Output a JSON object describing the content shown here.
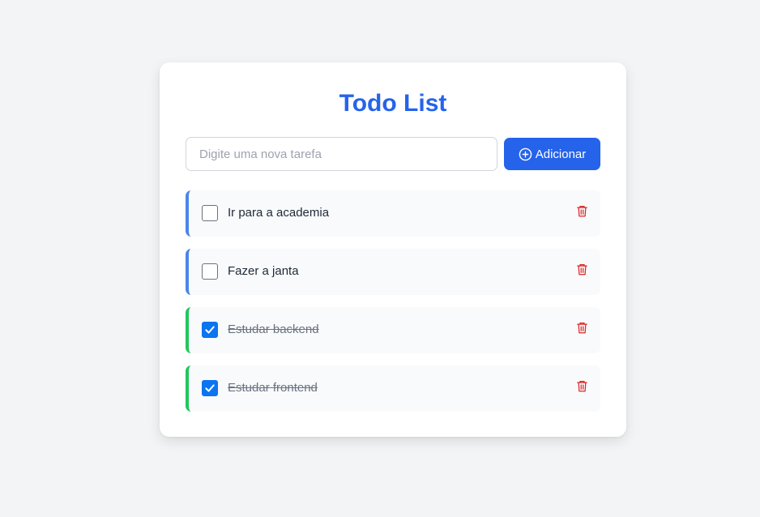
{
  "app": {
    "title": "Todo List"
  },
  "input": {
    "value": "",
    "placeholder": "Digite uma nova tarefa"
  },
  "add_button": {
    "label": "Adicionar",
    "icon": "plus-circle-icon"
  },
  "todos": [
    {
      "text": "Ir para a academia",
      "completed": false,
      "delete_icon": "trash-icon"
    },
    {
      "text": "Fazer a janta",
      "completed": false,
      "delete_icon": "trash-icon"
    },
    {
      "text": "Estudar backend",
      "completed": true,
      "delete_icon": "trash-icon"
    },
    {
      "text": "Estudar frontend",
      "completed": true,
      "delete_icon": "trash-icon"
    }
  ],
  "colors": {
    "page_background": "#f3f4f6",
    "accent": "#2563eb",
    "pending_border": "#4a86e8",
    "completed_border": "#22c55e",
    "delete_icon": "#dc2626",
    "checkbox_checked": "#0b74f0"
  }
}
